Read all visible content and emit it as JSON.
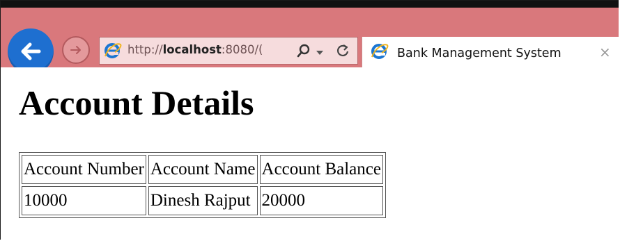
{
  "browser": {
    "url_prefix": "http://",
    "url_host": "localhost",
    "url_rest": ":8080/(",
    "tab_title": "Bank Management System",
    "tab_close": "×"
  },
  "page": {
    "heading": "Account Details",
    "table": {
      "headers": [
        "Account Number",
        "Account Name",
        "Account Balance"
      ],
      "rows": [
        [
          "10000",
          "Dinesh Rajput",
          "20000"
        ]
      ]
    }
  },
  "colors": {
    "chrome_bg": "#d9787c",
    "back_button": "#1e6fd0",
    "address_bg": "#f6dcdd"
  },
  "icons": {
    "back": "back-arrow-icon",
    "forward": "forward-arrow-icon",
    "browser": "internet-explorer-icon",
    "search": "search-icon",
    "dropdown": "dropdown-icon",
    "refresh": "refresh-icon",
    "close": "close-icon"
  }
}
